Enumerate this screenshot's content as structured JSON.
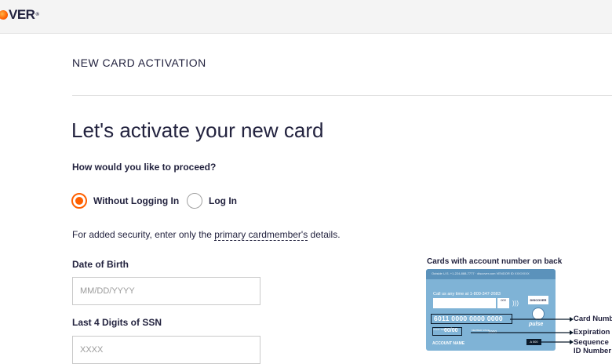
{
  "header": {
    "logo_text": "VER",
    "logo_icon": "discover-orange-dot"
  },
  "page": {
    "section_title": "NEW CARD ACTIVATION",
    "headline": "Let's activate your new card",
    "question": "How would you like to proceed?"
  },
  "options": {
    "selected": "without_login",
    "without_login_label": "Without Logging In",
    "login_label": "Log In"
  },
  "security_note": {
    "prefix": "For added security, enter only the ",
    "link_text": "primary cardmember's",
    "suffix": " details."
  },
  "form": {
    "dob_label": "Date of Birth",
    "dob_placeholder": "MM/DD/YYYY",
    "dob_value": "",
    "ssn_label": "Last 4 Digits of SSN",
    "ssn_placeholder": "XXXX",
    "ssn_value": ""
  },
  "card_example": {
    "caption": "Cards with account number on back",
    "strip_text": "Outside U.S. +1-224-888-7777 · discover.com        VENDOR ID  XXXXXXX",
    "call_text": "Call us any time at 1-800-347-2683",
    "cvv": "000",
    "brand": "DISCOVER",
    "card_number": "6011 0000 0000 0000",
    "valid_thru_tag": "VALID THRU",
    "expiration": "00/00",
    "member_since": "MEMBER SINCE",
    "member_year": "1000",
    "network": "pulse",
    "account_name": "ACCOUNT NAME",
    "sequence": "A 000",
    "callouts": {
      "card_number": "Card Numb",
      "expiration": "Expiration",
      "sequence_line1": "Sequence",
      "sequence_line2": "ID Number"
    },
    "colors": {
      "card": "#7fb3d6",
      "accent": "#ff6000"
    }
  }
}
